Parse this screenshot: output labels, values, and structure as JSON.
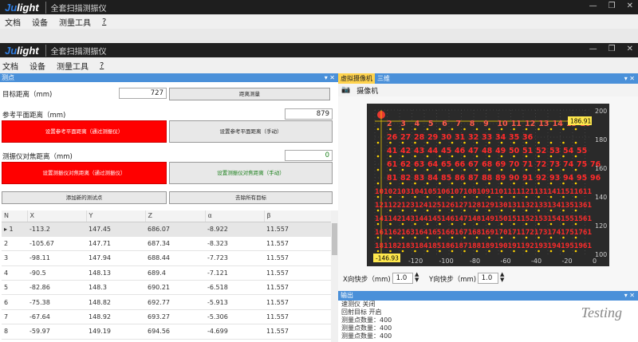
{
  "app": {
    "logo_prefix": "Ju",
    "logo_suffix": "light",
    "title": "全套扫描测振仪",
    "menu": [
      "文档",
      "设备",
      "测量工具",
      "?"
    ]
  },
  "left": {
    "panel_title": "测点",
    "target_distance_label": "目标距离（mm)",
    "target_distance_value": "727",
    "distance_measure_button": "距离测量",
    "ref_plane_label": "参考平面距离（mm)",
    "ref_plane_value": "879",
    "set_ref_auto_button": "设置参考平面距离（通过测振仪）",
    "set_ref_manual_button": "设置参考平面距离（手动）",
    "focus_label": "测振仪对焦距离（mm)",
    "focus_value": "0",
    "set_focus_auto_button": "设置测振仪对焦距离（通过测振仪）",
    "set_focus_manual_button": "设置测振仪对焦距离（手动）",
    "add_point_button": "添加新的测试点",
    "remove_targets_button": "去除所有目标",
    "columns": [
      "N",
      "X",
      "Y",
      "Z",
      "α",
      "β"
    ],
    "rows": [
      [
        "1",
        "-113.2",
        "147.45",
        "686.07",
        "-8.922",
        "11.557"
      ],
      [
        "2",
        "-105.67",
        "147.71",
        "687.34",
        "-8.323",
        "11.557"
      ],
      [
        "3",
        "-98.11",
        "147.94",
        "688.44",
        "-7.723",
        "11.557"
      ],
      [
        "4",
        "-90.5",
        "148.13",
        "689.4",
        "-7.121",
        "11.557"
      ],
      [
        "5",
        "-82.86",
        "148.3",
        "690.21",
        "-6.518",
        "11.557"
      ],
      [
        "6",
        "-75.38",
        "148.82",
        "692.77",
        "-5.913",
        "11.557"
      ],
      [
        "7",
        "-67.64",
        "148.92",
        "693.27",
        "-5.306",
        "11.557"
      ],
      [
        "8",
        "-59.97",
        "149.19",
        "694.56",
        "-4.699",
        "11.557"
      ]
    ]
  },
  "right": {
    "tabs": [
      "虚拟摄像机",
      "三维"
    ],
    "camera_label": "摄像机",
    "y_ticks": [
      "200",
      "180",
      "160",
      "140",
      "120",
      "100"
    ],
    "x_ticks": [
      "-120",
      "-100",
      "-80",
      "-60",
      "-40",
      "-20",
      "0"
    ],
    "y_readout": "186.91",
    "x_readout": "-146.93",
    "row1": [
      "2",
      "3",
      "4",
      "5",
      "6",
      "7",
      "8",
      "9",
      "10",
      "11",
      "12",
      "13",
      "14",
      "15",
      "16"
    ],
    "row2": [
      "26",
      "27",
      "28",
      "29",
      "30",
      "31",
      "32",
      "33",
      "34",
      "35",
      "36"
    ],
    "row3": [
      "41",
      "42",
      "43",
      "44",
      "45",
      "46",
      "47",
      "48",
      "49",
      "50",
      "51",
      "52",
      "53",
      "54",
      "55"
    ],
    "row4": [
      "61",
      "62",
      "63",
      "64",
      "65",
      "66",
      "67",
      "68",
      "69",
      "70",
      "71",
      "72",
      "73",
      "74",
      "75",
      "76"
    ],
    "row5": [
      "81",
      "82",
      "83",
      "84",
      "85",
      "86",
      "87",
      "88",
      "89",
      "90",
      "91",
      "92",
      "93",
      "94",
      "95",
      "96"
    ],
    "row6": "1010210310410510610710810911011111211311411511611",
    "row7": "1211221231241251261271281291301311321331341351361",
    "row8": "1411421431441451461471481491501511521531541551561",
    "row9": "1611621631641651661671681691701711721731741751761",
    "row10": "1811821831841851861871881891901911921931941951961",
    "x_step_label": "X向快步（mm)",
    "x_step_value": "1.0",
    "y_step_label": "Y向快步（mm)",
    "y_step_value": "1.0",
    "output_title": "输出",
    "output_lines": [
      "速测仪 关闭",
      "回射目标 开启",
      "测量点数量：400",
      "测量点数量：400",
      "测量点数量：400"
    ],
    "watermark": "Testing"
  }
}
